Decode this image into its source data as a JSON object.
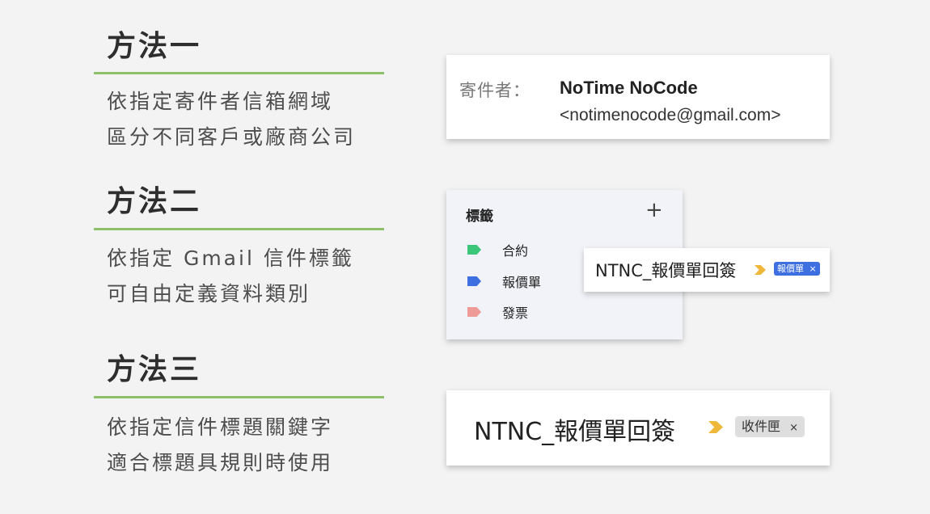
{
  "methods": [
    {
      "title": "方法一",
      "desc_line1": "依指定寄件者信箱網域",
      "desc_line2": "區分不同客戶或廠商公司"
    },
    {
      "title": "方法二",
      "desc_line1": "依指定 Gmail 信件標籤",
      "desc_line2": "可自由定義資料類別"
    },
    {
      "title": "方法三",
      "desc_line1": "依指定信件標題關鍵字",
      "desc_line2": "適合標題具規則時使用"
    }
  ],
  "sender_card": {
    "label": "寄件者：",
    "name": "NoTime NoCode",
    "email": "<notimenocode@gmail.com>"
  },
  "labels_panel": {
    "header": "標籤",
    "add_icon": "plus-icon",
    "items": [
      {
        "name": "合約",
        "color": "#3cc67a"
      },
      {
        "name": "報價單",
        "color": "#3d6fe0"
      },
      {
        "name": "發票",
        "color": "#ee9a96"
      }
    ]
  },
  "subject_card_small": {
    "subject": "NTNC_報價單回簽",
    "chip": "報價單",
    "chip_close": "×",
    "chip_color": "#3d6fe0"
  },
  "subject_card_large": {
    "subject": "NTNC_報價單回簽",
    "chip": "收件匣",
    "chip_close": "×"
  },
  "colors": {
    "accent_rule": "#8dc06a",
    "importance_marker": "#f0b83b"
  }
}
